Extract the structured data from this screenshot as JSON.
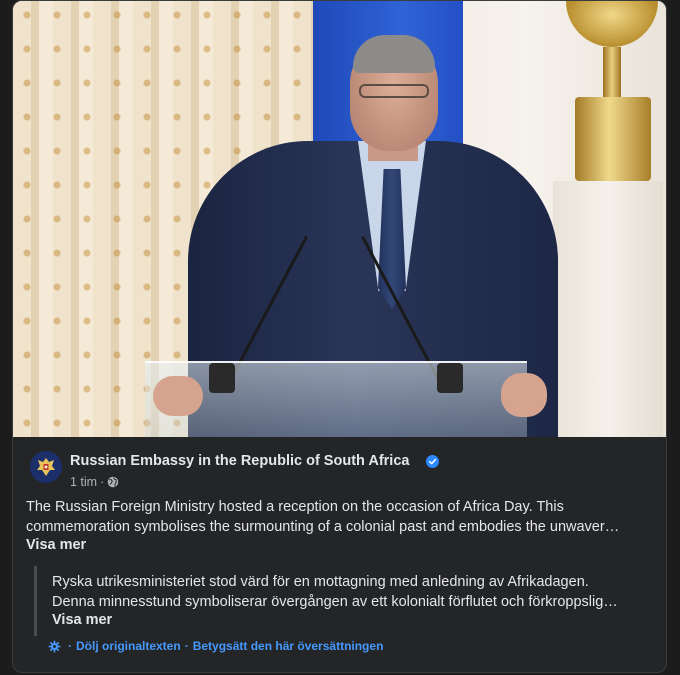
{
  "post": {
    "page_name": "Russian Embassy in the Republic of South Africa",
    "verified_icon": "verified-badge-icon",
    "timestamp": "1 tim",
    "separator": "·",
    "audience_icon": "globe-icon",
    "text_line1": "The Russian Foreign Ministry hosted a reception on the occasion of Africa Day. This",
    "text_line2": "commemoration symbolises the surmounting of a colonial past and embodies the unwaver…",
    "see_more": "Visa mer"
  },
  "translation": {
    "line1": "Ryska utrikesministeriet stod värd för en mottagning med anledning av Afrikadagen.",
    "line2": "Denna minnesstund symboliserar övergången av ett kolonialt förflutet och förkroppslig…",
    "see_more": "Visa mer",
    "hide_original": "Dölj originaltexten",
    "rate_translation": "Betygsätt den här översättningen",
    "separator": "·"
  },
  "colors": {
    "background": "#242526",
    "text": "#e4e6eb",
    "secondary_text": "#b0b3b8",
    "link": "#4599ff",
    "verified": "#2d88ff"
  }
}
